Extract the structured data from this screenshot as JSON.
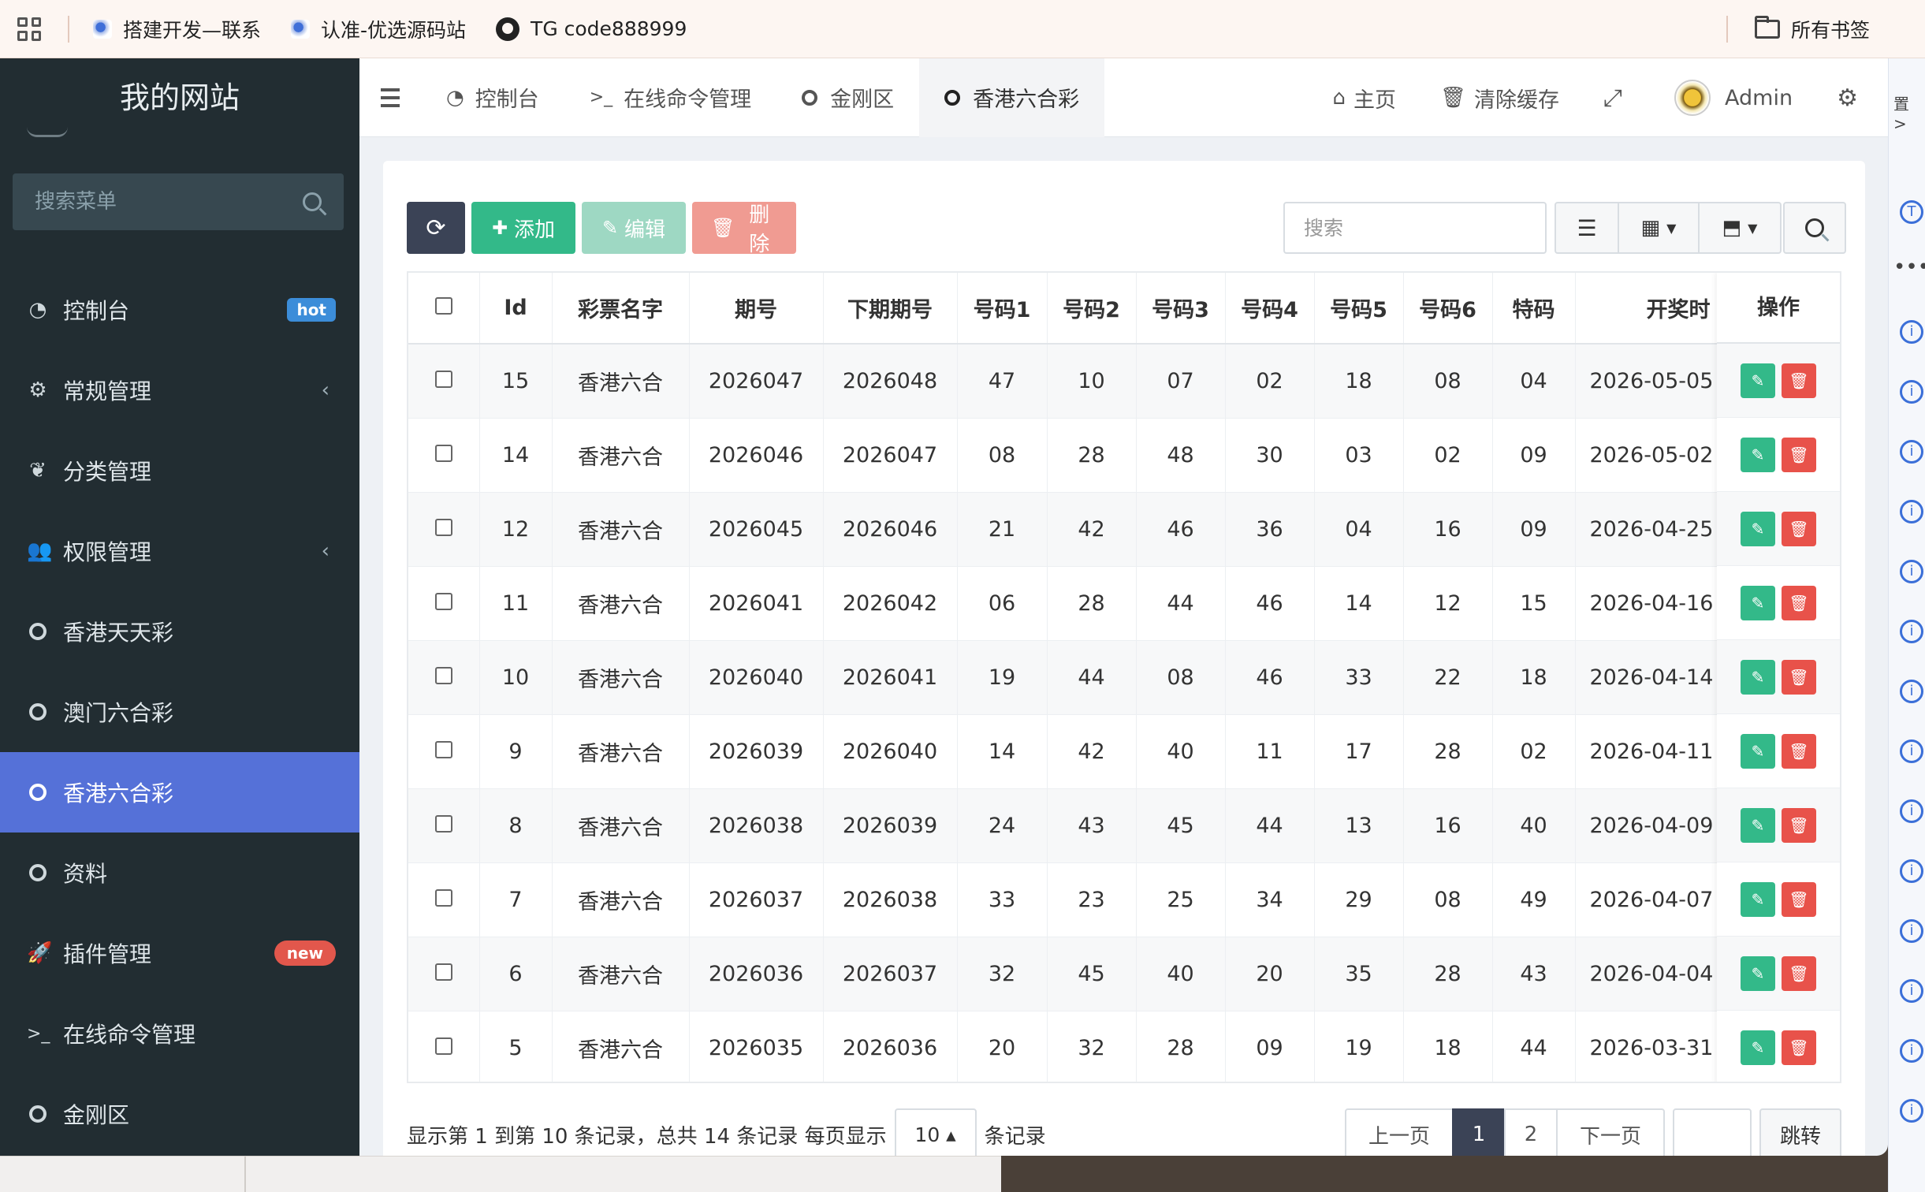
{
  "bookmarks": {
    "items": [
      {
        "label": "搭建开发—联系",
        "icon": "site-favicon-icon"
      },
      {
        "label": "认准-优选源码站",
        "icon": "site-favicon-icon"
      },
      {
        "label": "TG code888999",
        "icon": "github-icon"
      }
    ],
    "all_bookmarks": "所有书签"
  },
  "sidebar": {
    "site_title": "我的网站",
    "search_placeholder": "搜索菜单",
    "items": [
      {
        "label": "控制台",
        "icon": "dashboard-icon",
        "badge": "hot"
      },
      {
        "label": "常规管理",
        "icon": "gears-icon",
        "caret": "‹"
      },
      {
        "label": "分类管理",
        "icon": "leaf-icon"
      },
      {
        "label": "权限管理",
        "icon": "users-icon",
        "caret": "‹"
      },
      {
        "label": "香港天天彩",
        "icon": "circle-icon"
      },
      {
        "label": "澳门六合彩",
        "icon": "circle-icon"
      },
      {
        "label": "香港六合彩",
        "icon": "circle-icon",
        "active": true
      },
      {
        "label": "资料",
        "icon": "circle-icon"
      },
      {
        "label": "插件管理",
        "icon": "rocket-icon",
        "badge": "new"
      },
      {
        "label": "在线命令管理",
        "icon": "terminal-icon"
      },
      {
        "label": "金刚区",
        "icon": "circle-icon"
      }
    ]
  },
  "topnav": {
    "tabs": [
      {
        "label": "控制台",
        "icon": "dashboard-icon"
      },
      {
        "label": "在线命令管理",
        "icon": "terminal-icon"
      },
      {
        "label": "金刚区",
        "icon": "circle-icon"
      },
      {
        "label": "香港六合彩",
        "icon": "circle-icon",
        "active": true
      }
    ],
    "home": "主页",
    "clear_cache": "清除缓存",
    "user": "Admin"
  },
  "toolbar": {
    "add": "添加",
    "edit": "编辑",
    "delete": "删除",
    "search_placeholder": "搜索"
  },
  "table": {
    "columns": [
      "Id",
      "彩票名字",
      "期号",
      "下期期号",
      "号码1",
      "号码2",
      "号码3",
      "号码4",
      "号码5",
      "号码6",
      "特码",
      "开奖时"
    ],
    "ops_header": "操作",
    "rows": [
      [
        "15",
        "香港六合",
        "2026047",
        "2026048",
        "47",
        "10",
        "07",
        "02",
        "18",
        "08",
        "04",
        "2026-05-05"
      ],
      [
        "14",
        "香港六合",
        "2026046",
        "2026047",
        "08",
        "28",
        "48",
        "30",
        "03",
        "02",
        "09",
        "2026-05-02"
      ],
      [
        "12",
        "香港六合",
        "2026045",
        "2026046",
        "21",
        "42",
        "46",
        "36",
        "04",
        "16",
        "09",
        "2026-04-25"
      ],
      [
        "11",
        "香港六合",
        "2026041",
        "2026042",
        "06",
        "28",
        "44",
        "46",
        "14",
        "12",
        "15",
        "2026-04-16"
      ],
      [
        "10",
        "香港六合",
        "2026040",
        "2026041",
        "19",
        "44",
        "08",
        "46",
        "33",
        "22",
        "18",
        "2026-04-14"
      ],
      [
        "9",
        "香港六合",
        "2026039",
        "2026040",
        "14",
        "42",
        "40",
        "11",
        "17",
        "28",
        "02",
        "2026-04-11"
      ],
      [
        "8",
        "香港六合",
        "2026038",
        "2026039",
        "24",
        "43",
        "45",
        "44",
        "13",
        "16",
        "40",
        "2026-04-09"
      ],
      [
        "7",
        "香港六合",
        "2026037",
        "2026038",
        "33",
        "23",
        "25",
        "34",
        "29",
        "08",
        "49",
        "2026-04-07"
      ],
      [
        "6",
        "香港六合",
        "2026036",
        "2026037",
        "32",
        "45",
        "40",
        "20",
        "35",
        "28",
        "43",
        "2026-04-04"
      ],
      [
        "5",
        "香港六合",
        "2026035",
        "2026036",
        "20",
        "32",
        "28",
        "09",
        "19",
        "18",
        "44",
        "2026-03-31"
      ]
    ]
  },
  "footer": {
    "info": "显示第 1 到第 10 条记录，总共 14 条记录 每页显示",
    "page_size": "10 ▴",
    "info_suffix": "条记录",
    "prev": "上一页",
    "pages": [
      "1",
      "2"
    ],
    "current_page": "1",
    "next": "下一页",
    "jump": "跳转"
  },
  "peek": {
    "text": "置 >"
  }
}
